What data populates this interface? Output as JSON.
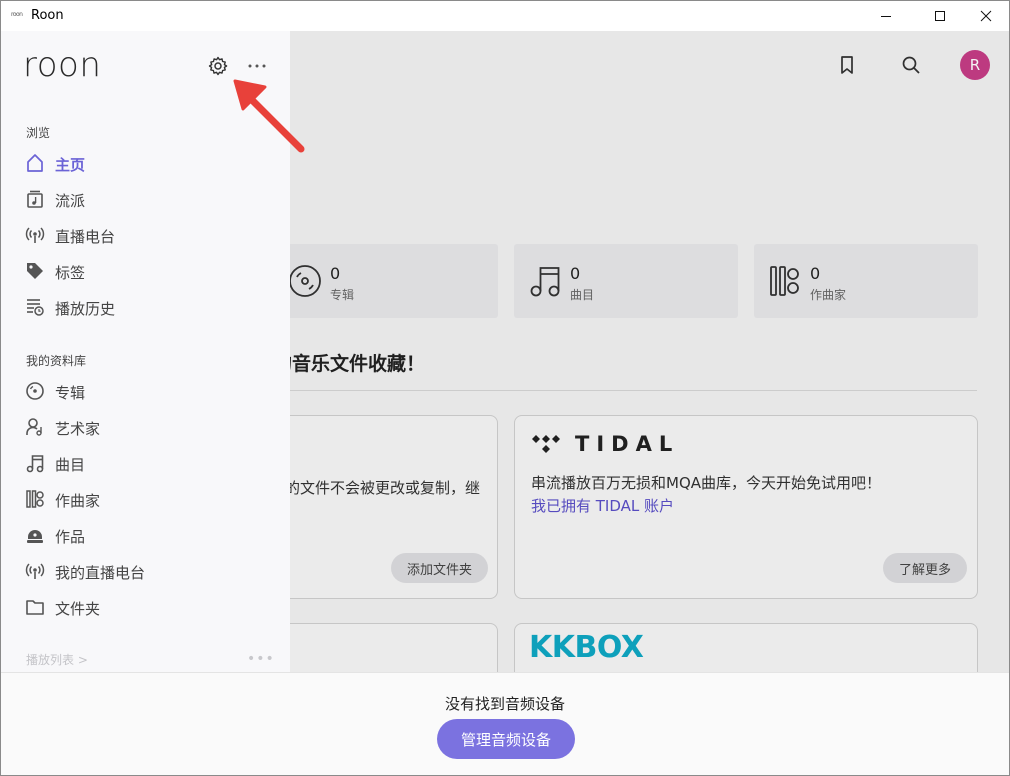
{
  "window": {
    "title": "Roon",
    "icon_text": "roon"
  },
  "sidebar": {
    "logo": "roon",
    "browse_title": "浏览",
    "browse_items": [
      {
        "label": "主页",
        "icon": "home-icon",
        "active": true
      },
      {
        "label": "流派",
        "icon": "genre-icon"
      },
      {
        "label": "直播电台",
        "icon": "radio-icon"
      },
      {
        "label": "标签",
        "icon": "tag-icon"
      },
      {
        "label": "播放历史",
        "icon": "history-icon"
      }
    ],
    "library_title": "我的资料库",
    "library_items": [
      {
        "label": "专辑",
        "icon": "album-icon"
      },
      {
        "label": "艺术家",
        "icon": "artist-icon"
      },
      {
        "label": "曲目",
        "icon": "track-icon"
      },
      {
        "label": "作曲家",
        "icon": "composer-icon"
      },
      {
        "label": "作品",
        "icon": "composition-icon"
      },
      {
        "label": "我的直播电台",
        "icon": "my-radio-icon"
      },
      {
        "label": "文件夹",
        "icon": "folder-icon"
      }
    ],
    "playlists_label": "播放列表 >"
  },
  "main": {
    "stats": [
      {
        "value": "0",
        "label": "专辑",
        "icon": "album-icon"
      },
      {
        "value": "0",
        "label": "曲目",
        "icon": "track-icon"
      },
      {
        "value": "0",
        "label": "作曲家",
        "icon": "composer-icon"
      }
    ],
    "section_title": "的音乐文件收藏！",
    "folder_card": {
      "text": "的文件不会被更改或复制，继",
      "button": "添加文件夹"
    },
    "tidal_card": {
      "brand": "TIDAL",
      "text": "串流播放百万无损和MQA曲库，今天开始免试用吧！",
      "link": "我已拥有 TIDAL 账户",
      "button": "了解更多"
    },
    "kkbox_card": {
      "brand": "KKBOX"
    },
    "avatar_letter": "R"
  },
  "bottom": {
    "no_device": "没有找到音频设备",
    "manage_button": "管理音频设备"
  },
  "colors": {
    "accent": "#6b63d6",
    "button": "#7b72e0",
    "avatar": "#c63d86",
    "kkbox": "#0fa8c4",
    "arrow": "#e8413a"
  }
}
